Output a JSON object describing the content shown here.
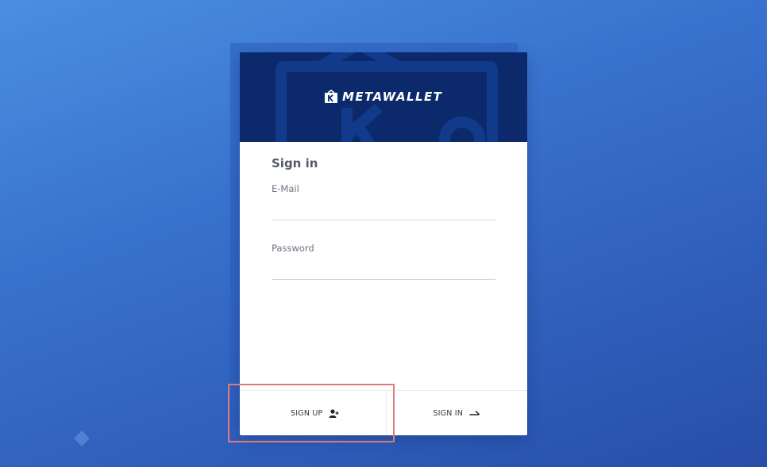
{
  "brand": {
    "name": "METAWALLET",
    "logo_icon": "wallet-logo-icon",
    "header_color": "#0c2a6b"
  },
  "form": {
    "title": "Sign in",
    "email": {
      "label": "E-Mail",
      "value": "",
      "placeholder": ""
    },
    "password": {
      "label": "Password",
      "value": "",
      "placeholder": ""
    }
  },
  "actions": {
    "sign_up": {
      "label": "SIGN UP",
      "icon": "add-user-icon"
    },
    "sign_in": {
      "label": "SIGN IN",
      "icon": "arrow-right-icon"
    }
  },
  "colors": {
    "background_start": "#4a8fe0",
    "background_end": "#274ea8",
    "highlight": "#e07a7a"
  }
}
